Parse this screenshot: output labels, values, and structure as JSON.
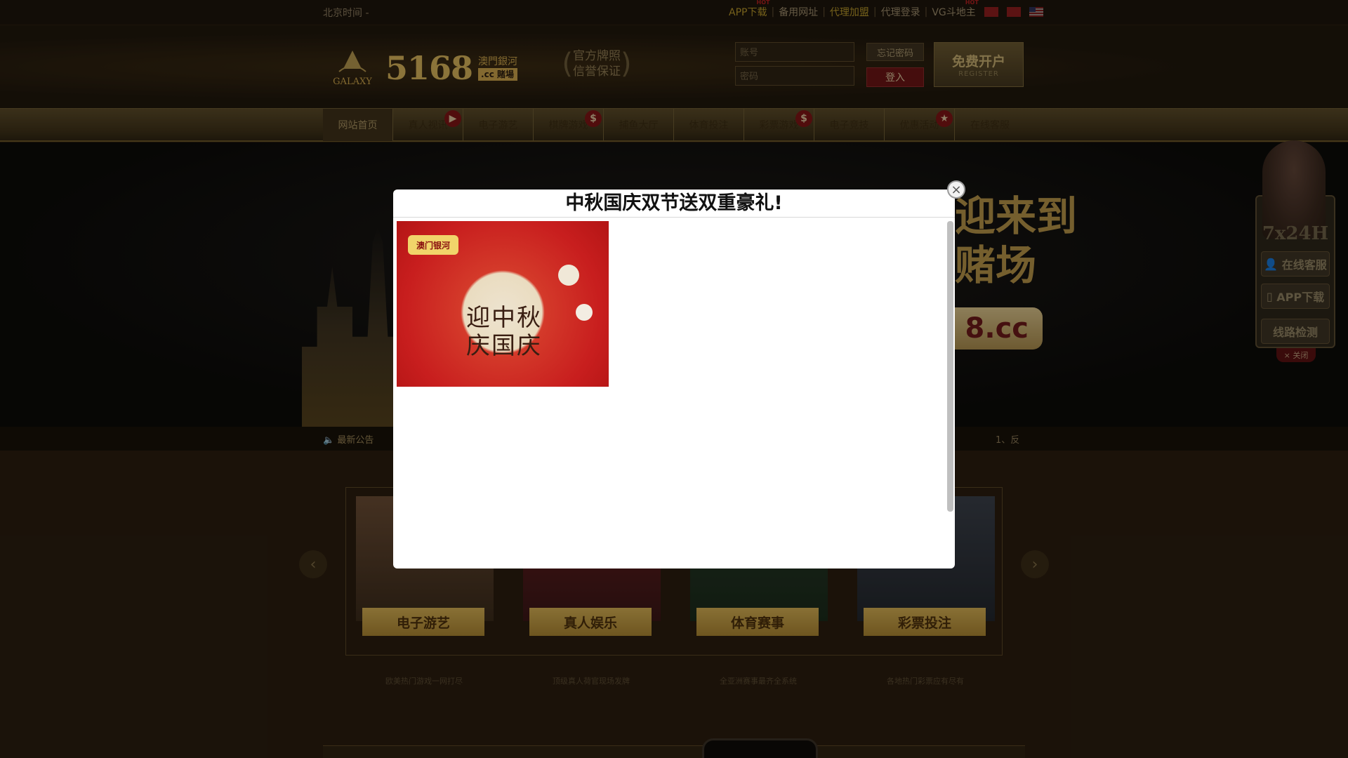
{
  "topbar": {
    "time": "北京时间 -",
    "links": [
      {
        "label": "APP下载",
        "hot": true
      },
      {
        "label": "备用网址"
      },
      {
        "label": "代理加盟",
        "accent": true
      },
      {
        "label": "代理登录"
      },
      {
        "label": "VG斗地主",
        "hot": true
      }
    ],
    "hot_tag": "HOT"
  },
  "header": {
    "logo_brand": "GALAXY",
    "logo_number": "5168",
    "logo_sub1": "澳門銀河",
    "logo_sub2": ".cc 賭場",
    "badge_line1": "官方牌照",
    "badge_line2": "信誉保证",
    "account_placeholder": "账号",
    "password_placeholder": "密码",
    "forgot_label": "忘记密码",
    "login_label": "登入",
    "register_label": "免费开户",
    "register_sub": "REGISTER"
  },
  "nav": {
    "items": [
      {
        "label": "网站首页",
        "active": true
      },
      {
        "label": "真人视讯",
        "badge": "▶"
      },
      {
        "label": "电子游艺"
      },
      {
        "label": "棋牌游戏",
        "badge": "$"
      },
      {
        "label": "捕鱼大厅"
      },
      {
        "label": "体育投注"
      },
      {
        "label": "彩票游戏",
        "badge": "$"
      },
      {
        "label": "电子竞技"
      },
      {
        "label": "优惠活动",
        "badge": "★"
      },
      {
        "label": "在线客服"
      }
    ]
  },
  "banner": {
    "line1": "迎来到",
    "line2": "赌场",
    "url_fragment": "8.cc"
  },
  "ticker": {
    "label": "最新公告",
    "text": "1、反"
  },
  "cards": [
    {
      "label": "电子游艺",
      "desc": "欧美热门游戏一网打尽"
    },
    {
      "label": "真人娱乐",
      "desc": "顶级真人荷官现场发牌"
    },
    {
      "label": "体育赛事",
      "desc": "全亚洲赛事最齐全系统"
    },
    {
      "label": "彩票投注",
      "desc": "各地热门彩票应有尽有"
    }
  ],
  "side": {
    "hours": "7x24H",
    "service": "在线客服",
    "app": "APP下载",
    "line_check": "线路检测",
    "close": "× 关闭"
  },
  "modal": {
    "title": "中秋国庆双节送双重豪礼!",
    "promo_tag": "澳门银河",
    "promo_text": "迎中秋 庆国庆",
    "close": "×"
  },
  "colors": {
    "accent_gold": "#d6b35a",
    "background": "#2a1d0f",
    "modal_bg": "#ffffff",
    "promo_red": "#c81e1e"
  }
}
